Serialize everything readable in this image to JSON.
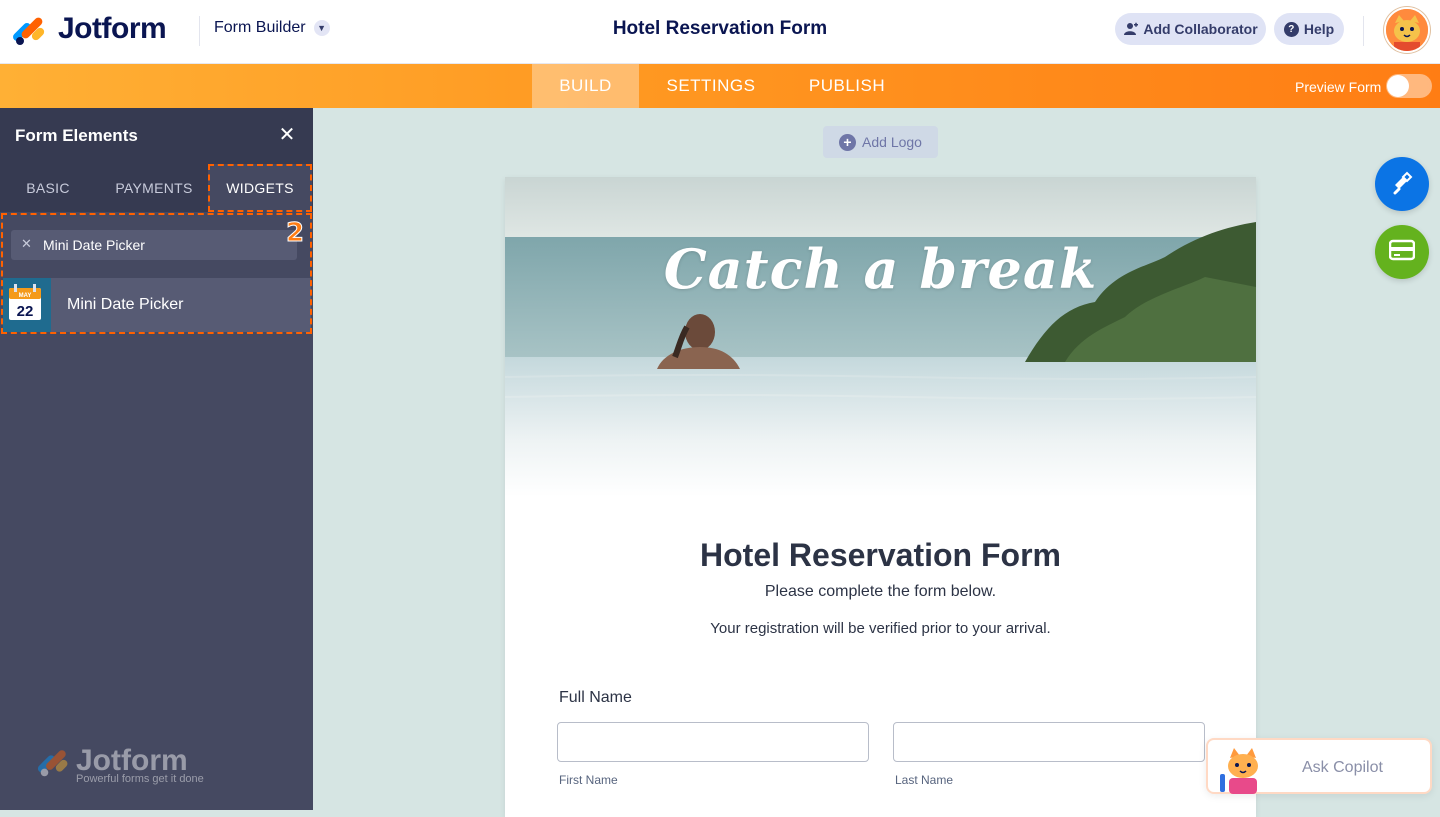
{
  "topbar": {
    "brand": "Jotform",
    "mode_select": "Form Builder",
    "form_title": "Hotel Reservation Form",
    "add_collaborator": "Add Collaborator",
    "help": "Help"
  },
  "nav": {
    "tabs": [
      "BUILD",
      "SETTINGS",
      "PUBLISH"
    ],
    "active_tab": "BUILD",
    "preview_label": "Preview Form",
    "preview_enabled": false
  },
  "sidebar": {
    "title": "Form Elements",
    "tabs": [
      "BASIC",
      "PAYMENTS",
      "WIDGETS"
    ],
    "active_tab": "WIDGETS",
    "step_marker": "2",
    "search_value": "Mini Date Picker",
    "results": [
      {
        "label": "Mini Date Picker",
        "icon": "calendar-icon",
        "icon_month": "MAY",
        "icon_day": "22"
      }
    ],
    "footer_brand": "Jotform",
    "footer_tagline": "Powerful forms get it done"
  },
  "canvas": {
    "add_logo": "Add Logo",
    "hero_text": "Catch a break",
    "heading": "Hotel Reservation Form",
    "subheading": "Please complete the form below.",
    "note": "Your registration will be verified prior to your arrival.",
    "fields": [
      {
        "label": "Full Name",
        "sub_fields": [
          {
            "sublabel": "First Name",
            "value": ""
          },
          {
            "sublabel": "Last Name",
            "value": ""
          }
        ]
      }
    ]
  },
  "floating": {
    "designer_icon": "paint-roller-icon",
    "payment_icon": "card-icon"
  },
  "copilot": {
    "label": "Ask Copilot"
  },
  "colors": {
    "brand_orange": "#ff6100",
    "nav_gradient_start": "#ffb035",
    "nav_gradient_end": "#ff7d14",
    "brand_navy": "#0a1551",
    "sidebar_bg": "#454961",
    "canvas_bg": "#d6e5e3",
    "designer_blue": "#0b74e5",
    "payment_green": "#64b21e"
  }
}
